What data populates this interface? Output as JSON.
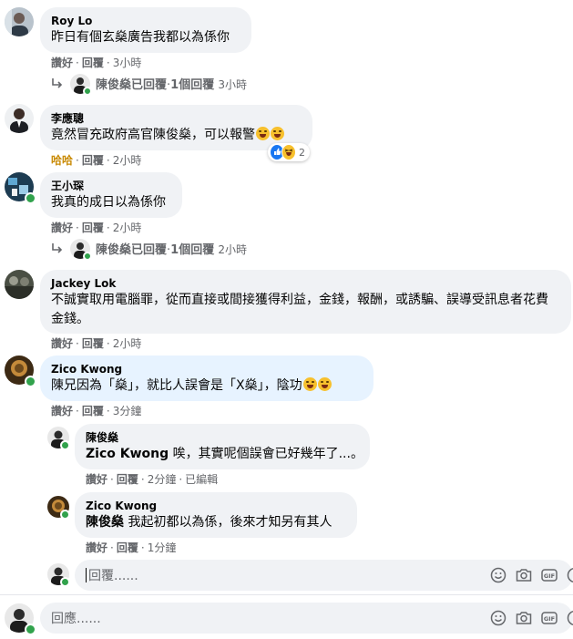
{
  "comments": [
    {
      "author": "Roy Lo",
      "text": "昨日有個玄燊廣告我都以為係你",
      "actions": {
        "like": "讚好",
        "reply": "回覆",
        "time": "3小時"
      },
      "replies_summary": {
        "replier": "陳俊燊已回覆",
        "count": "1個回覆",
        "time": "3小時"
      }
    },
    {
      "author": "李應聰",
      "text": "竟然冒充政府高官陳俊燊，可以報警",
      "actions": {
        "like": "哈哈",
        "reply": "回覆",
        "time": "2小時"
      },
      "reaction_count": "2"
    },
    {
      "author": "王小琛",
      "text": "我真的成日以為係你",
      "actions": {
        "like": "讚好",
        "reply": "回覆",
        "time": "2小時"
      },
      "replies_summary": {
        "replier": "陳俊燊已回覆",
        "count": "1個回覆",
        "time": "2小時"
      }
    },
    {
      "author": "Jackey Lok",
      "text": "不誠實取用電腦罪，從而直接或間接獲得利益，金錢，報酬，或誘騙、誤導受訊息者花費金錢。",
      "actions": {
        "like": "讚好",
        "reply": "回覆",
        "time": "2小時"
      }
    },
    {
      "author": "Zico Kwong",
      "text": "陳兄因為「燊」，就比人誤會是「X燊」，陰功",
      "actions": {
        "like": "讚好",
        "reply": "回覆",
        "time": "3分鐘"
      }
    }
  ],
  "replies": [
    {
      "author": "陳俊燊",
      "mention": "Zico Kwong",
      "text": " 唉，其實呢個誤會已好幾年了...。",
      "actions": {
        "like": "讚好",
        "reply": "回覆",
        "time": "2分鐘",
        "edited": "已編輯"
      }
    },
    {
      "author": "Zico Kwong",
      "mention": "陳俊燊",
      "text": " 我起初都以為係，後來才知另有其人",
      "actions": {
        "like": "讚好",
        "reply": "回覆",
        "time": "1分鐘"
      }
    }
  ],
  "reply_input": {
    "placeholder": "回覆......"
  },
  "comment_input": {
    "placeholder": "回應......"
  },
  "separator": "·"
}
